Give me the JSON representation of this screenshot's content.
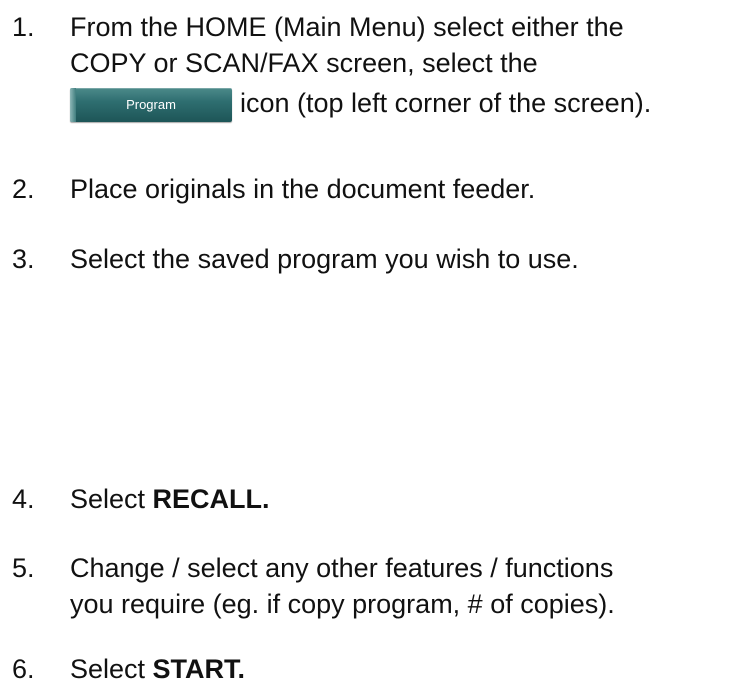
{
  "steps": [
    {
      "number": "1.",
      "lines": [
        "From  the HOME (Main Menu) select either the",
        "COPY or SCAN/FAX screen, select the"
      ],
      "icon_label": "Program",
      "icon_name": "program-button-icon",
      "after_icon": "icon (top left corner of the screen)."
    },
    {
      "number": "2.",
      "text": "Place originals in the document feeder."
    },
    {
      "number": "3.",
      "text": "Select the saved program you wish to use."
    },
    {
      "number": "4.",
      "prefix": "Select ",
      "bold": "RECALL."
    },
    {
      "number": "5.",
      "lines": [
        "Change / select any other features / functions",
        "you require (eg. if copy program, # of copies)."
      ]
    },
    {
      "number": "6.",
      "prefix": "Select ",
      "bold": "START."
    }
  ],
  "colors": {
    "program_button": "#2e6e70",
    "text": "#111111"
  }
}
